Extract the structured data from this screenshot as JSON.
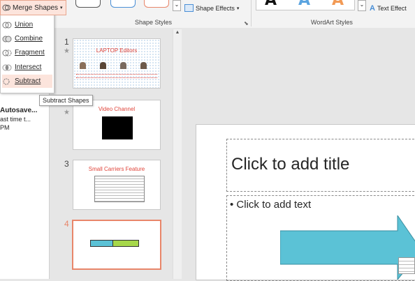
{
  "ribbon": {
    "merge_shapes_label": "Merge Shapes",
    "shape_effects_label": "Shape Effects",
    "shape_styles_label": "Shape Styles",
    "wordart_styles_label": "WordArt Styles",
    "text_effects_label": "Text Effect",
    "wordart_letter": "A"
  },
  "merge_menu": {
    "items": [
      {
        "label": "Union",
        "icon": "union-icon"
      },
      {
        "label": "Combine",
        "icon": "combine-icon"
      },
      {
        "label": "Fragment",
        "icon": "fragment-icon"
      },
      {
        "label": "Intersect",
        "icon": "intersect-icon"
      },
      {
        "label": "Subtract",
        "icon": "subtract-icon"
      }
    ],
    "tooltip": "Subtract Shapes"
  },
  "left_pane": {
    "autosave_title": "Autosave...",
    "autosave_line2": "ast time t...",
    "autosave_line3": "PM"
  },
  "slides": [
    {
      "number": "1",
      "title": "LAPTOP Editors"
    },
    {
      "number": "",
      "title": "Video Channel"
    },
    {
      "number": "3",
      "title": "Small Carriers Feature"
    },
    {
      "number": "4",
      "title": ""
    }
  ],
  "main_slide": {
    "title_placeholder": "Click to add title",
    "body_placeholder": "• Click to add text"
  },
  "colors": {
    "accent": "#e8866a",
    "arrow_fill": "#5bc2d6",
    "thumb_arrow_green": "#a6d84a",
    "slide_title_red": "#e0443a"
  }
}
